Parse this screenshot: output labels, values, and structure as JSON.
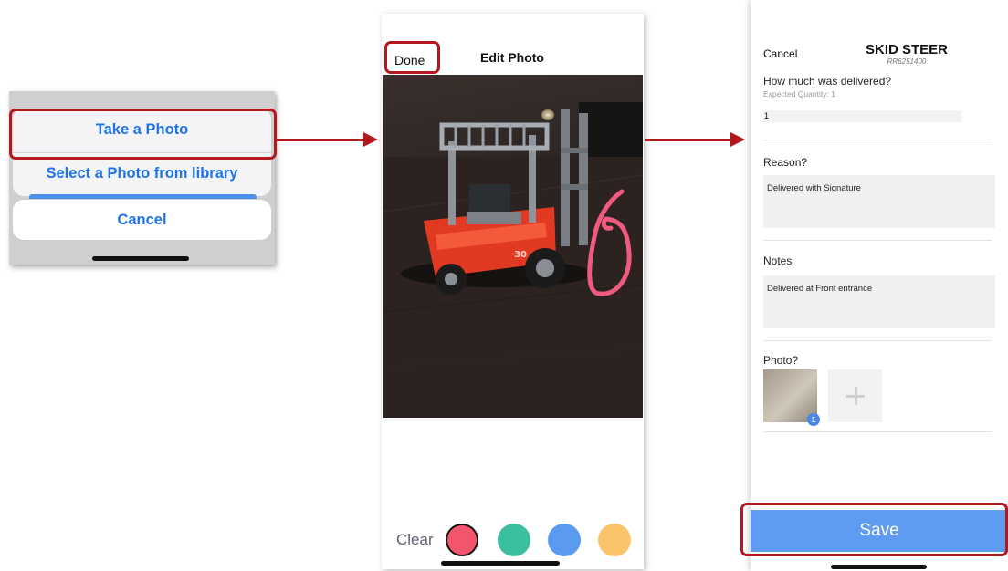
{
  "sheet": {
    "take_photo": "Take a Photo",
    "select_library": "Select a Photo from library",
    "cancel": "Cancel"
  },
  "editor": {
    "done": "Done",
    "title": "Edit Photo",
    "clear": "Clear",
    "photo_text": "30",
    "colors": [
      {
        "name": "red",
        "hex": "#f2566c"
      },
      {
        "name": "teal",
        "hex": "#3bbf9f"
      },
      {
        "name": "blue",
        "hex": "#5a9af0"
      },
      {
        "name": "yellow",
        "hex": "#f9c46a"
      }
    ],
    "selected_color": "red"
  },
  "form": {
    "cancel": "Cancel",
    "title": "SKID STEER",
    "subtitle": "RR6251400",
    "delivered_question": "How much was delivered?",
    "expected_quantity": "Expected Quantity: 1",
    "quantity_value": "1",
    "reason_label": "Reason?",
    "reason_value": "Delivered with Signature",
    "notes_label": "Notes",
    "notes_value": "Delivered at Front entrance",
    "photo_label": "Photo?",
    "photo_badge": "1",
    "add_photo_icon": "plus-icon",
    "save": "Save"
  },
  "colors": {
    "highlight": "#b3181d",
    "ios_blue": "#1f73e8",
    "save_blue": "#5e9cf2"
  }
}
